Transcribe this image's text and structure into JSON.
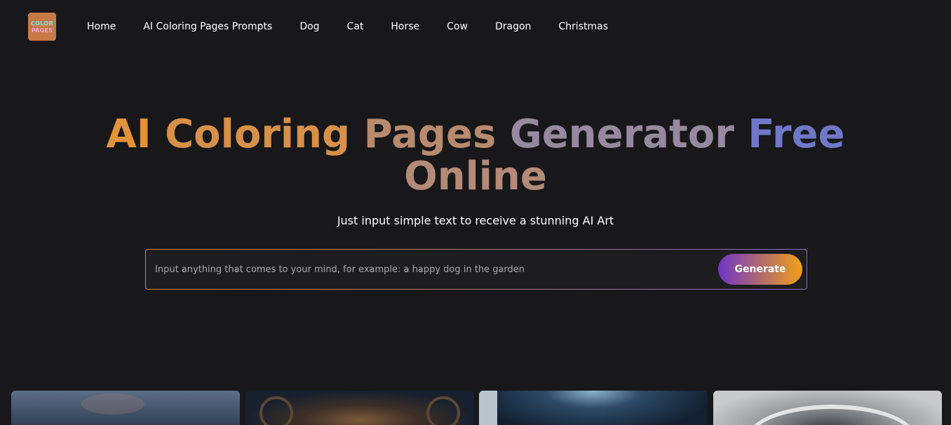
{
  "logo": {
    "line1": "COLOR",
    "line2": "PAGES"
  },
  "nav": {
    "items": [
      {
        "label": "Home"
      },
      {
        "label": "AI Coloring Pages Prompts"
      },
      {
        "label": "Dog"
      },
      {
        "label": "Cat"
      },
      {
        "label": "Horse"
      },
      {
        "label": "Cow"
      },
      {
        "label": "Dragon"
      },
      {
        "label": "Christmas"
      }
    ]
  },
  "hero": {
    "title_words": {
      "ai": "AI",
      "coloring": "Coloring",
      "pages": "Pages",
      "generator": "Generator",
      "free": "Free",
      "online": "Online"
    },
    "subtitle": "Just input simple text to receive a stunning AI Art"
  },
  "search": {
    "value": "",
    "placeholder": "Input anything that comes to your mind, for example: a happy dog in the garden",
    "button_label": "Generate"
  },
  "colors": {
    "background": "#18171a",
    "title_gradient_start": "#e2933a",
    "title_gradient_end": "#6f78c8",
    "button_gradient_start": "#6f35c8",
    "button_gradient_end": "#f2a018"
  }
}
